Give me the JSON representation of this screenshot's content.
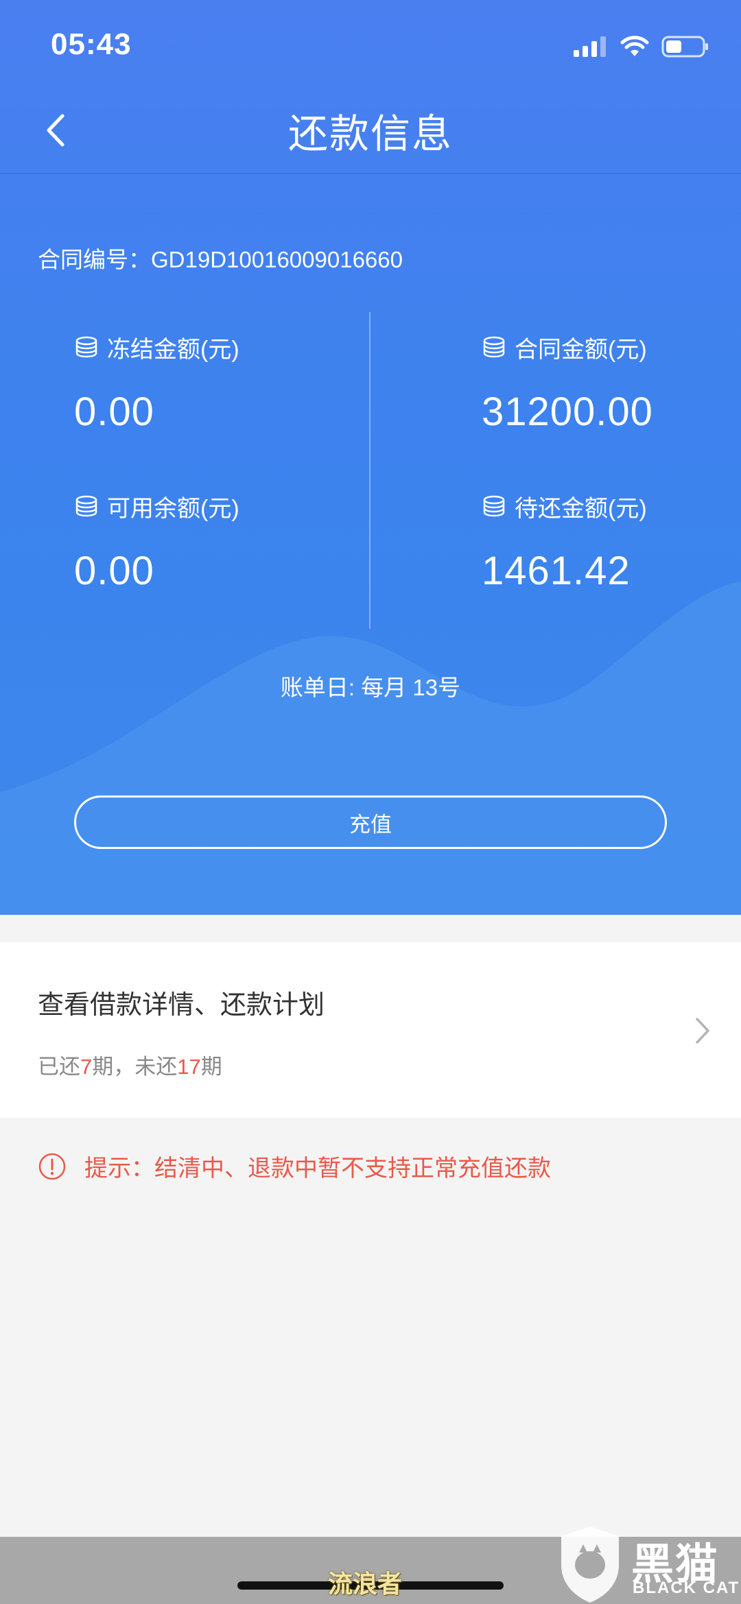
{
  "status_bar": {
    "time": "05:43"
  },
  "nav": {
    "title": "还款信息"
  },
  "contract": {
    "label": "合同编号：",
    "number": "GD19D10016009016660"
  },
  "stats": {
    "frozen": {
      "label": "冻结金额(元)",
      "value": "0.00"
    },
    "contract_amount": {
      "label": "合同金额(元)",
      "value": "31200.00"
    },
    "available": {
      "label": "可用余额(元)",
      "value": "0.00"
    },
    "pending": {
      "label": "待还金额(元)",
      "value": "1461.42"
    }
  },
  "bill_day": "账单日: 每月 13号",
  "recharge_button": "充值",
  "loan_card": {
    "title": "查看借款详情、还款计划",
    "paid_prefix": "已还",
    "paid_count": "7",
    "paid_suffix": "期，未还",
    "unpaid_count": "17",
    "unpaid_suffix": "期"
  },
  "tip": "提示：结清中、退款中暂不支持正常充值还款",
  "watermark": {
    "text": "流浪者",
    "logo_cn": "黑猫",
    "logo_en": "BLACK CAT"
  },
  "colors": {
    "primary_blue": "#3d82ee",
    "warning_red": "#e8594a",
    "page_bg": "#f4f4f4"
  }
}
